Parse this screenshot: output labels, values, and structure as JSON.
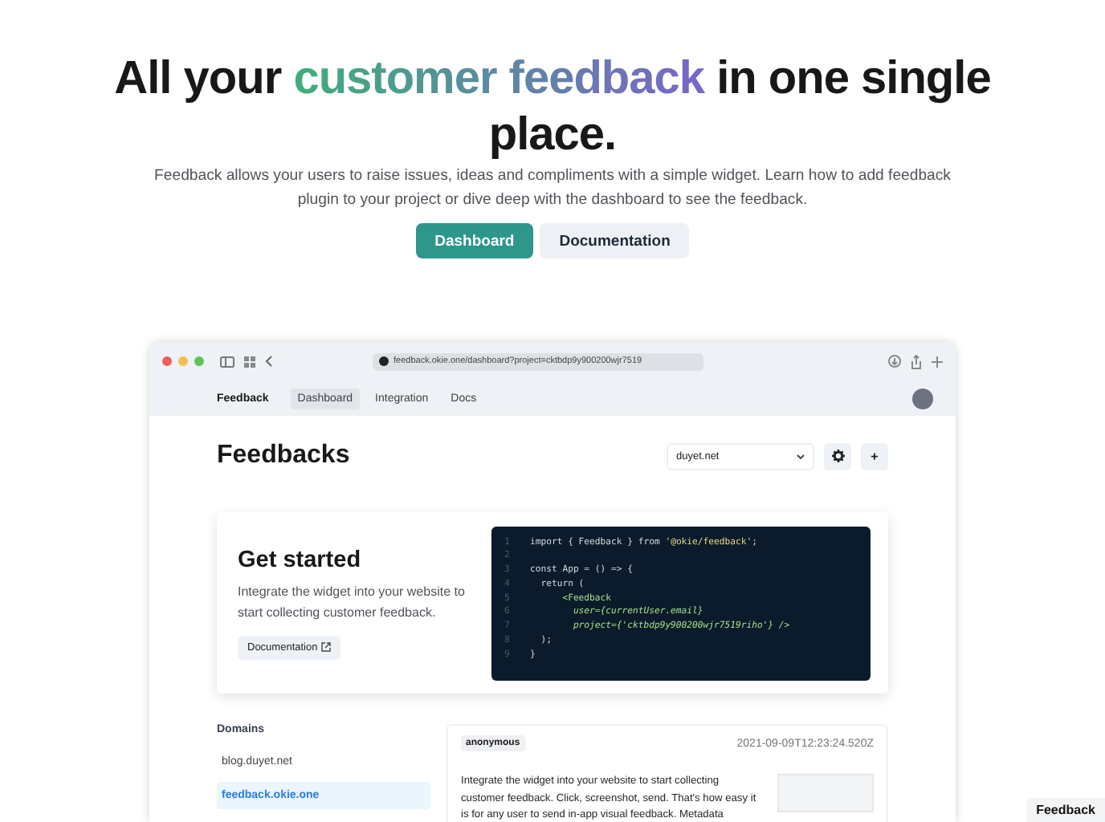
{
  "hero": {
    "title_before": "All your",
    "title_highlight": "customer feedback",
    "title_after": "in one single place.",
    "description": "Feedback allows your users to raise issues, ideas and compliments with a simple widget. Learn how to add feedback plugin to your project or dive deep with the dashboard to see the feedback.",
    "buttons": [
      {
        "label": "Dashboard",
        "kind": "primary"
      },
      {
        "label": "Documentation",
        "kind": "secondary"
      }
    ]
  },
  "browser": {
    "url": "feedback.okie.one/dashboard?project=cktbdp9y900200wjr7519"
  },
  "nav": {
    "brand": "Feedback",
    "items": [
      {
        "label": "Dashboard",
        "selected": true
      },
      {
        "label": "Integration",
        "selected": false
      },
      {
        "label": "Docs",
        "selected": false
      }
    ]
  },
  "dashboard": {
    "title": "Feedbacks",
    "domain_select": "duyet.net",
    "add_button": "+"
  },
  "get_started": {
    "title": "Get started",
    "text": "Integrate the widget into your website to start collecting customer feedback.",
    "button": "Documentation",
    "code": [
      {
        "number": "1",
        "tokens": [
          {
            "text": "import { Feedback } from ",
            "kind": "plain"
          },
          {
            "text": "'@okie/feedback'",
            "kind": "string"
          },
          {
            "text": ";",
            "kind": "plain"
          }
        ]
      },
      {
        "number": "2"
      },
      {
        "number": "3",
        "tokens": [
          {
            "text": "const App = () => {",
            "kind": "plain"
          }
        ]
      },
      {
        "number": "4",
        "tokens": [
          {
            "text": "  return (",
            "kind": "plain"
          }
        ]
      },
      {
        "number": "5",
        "tokens": [
          {
            "text": "      <Feedback",
            "kind": "tag"
          }
        ]
      },
      {
        "number": "6",
        "tokens": [
          {
            "text": "        user={currentUser.email}",
            "kind": "attr"
          }
        ]
      },
      {
        "number": "7",
        "tokens": [
          {
            "text": "        project={'cktbdp9y900200wjr7519riho'} />",
            "kind": "attr"
          }
        ]
      },
      {
        "number": "8",
        "tokens": [
          {
            "text": "  );",
            "kind": "plain"
          }
        ]
      },
      {
        "number": "9",
        "tokens": [
          {
            "text": "}",
            "kind": "plain"
          }
        ]
      }
    ]
  },
  "domains": {
    "title": "Domains",
    "items": [
      {
        "label": "blog.duyet.net",
        "selected": false
      },
      {
        "label": "feedback.okie.one",
        "selected": true
      }
    ]
  },
  "feedback_item": {
    "user": "anonymous",
    "time": "2021-09-09T12:23:24.520Z",
    "text": "Integrate the widget into your website to start collecting customer feedback. Click, screenshot, send. That's how easy it is for any user to send in-app visual feedback. Metadata"
  },
  "widget_button": "Feedback"
}
